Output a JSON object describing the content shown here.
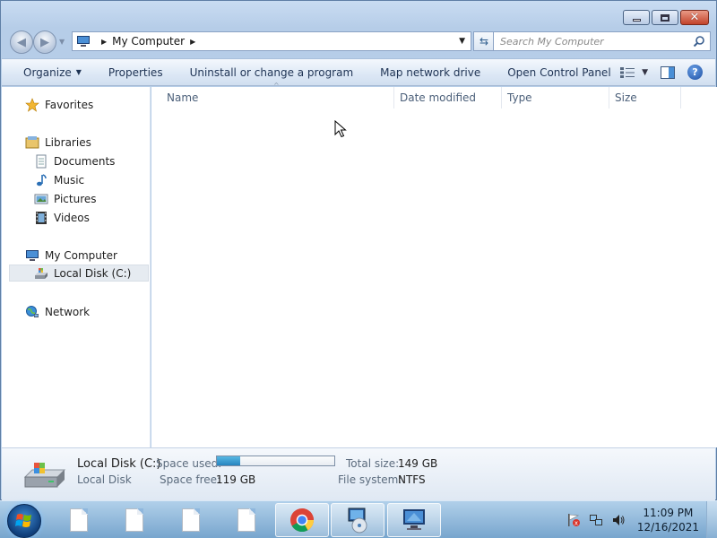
{
  "address": {
    "breadcrumb": [
      "My Computer"
    ],
    "search_placeholder": "Search My Computer"
  },
  "toolbar": {
    "organize": "Organize",
    "properties": "Properties",
    "uninstall": "Uninstall or change a program",
    "map_drive": "Map network drive",
    "control_panel": "Open Control Panel"
  },
  "navpane": {
    "favorites": "Favorites",
    "libraries": "Libraries",
    "documents": "Documents",
    "music": "Music",
    "pictures": "Pictures",
    "videos": "Videos",
    "my_computer": "My Computer",
    "local_disk": "Local Disk (C:)",
    "network": "Network"
  },
  "columns": {
    "name": "Name",
    "date_modified": "Date modified",
    "type": "Type",
    "size": "Size"
  },
  "details": {
    "title": "Local Disk (C:)",
    "subtitle": "Local Disk",
    "space_used_label": "Space used:",
    "space_used_fraction": 0.2,
    "total_size_label": "Total size:",
    "total_size_value": "149 GB",
    "space_free_label": "Space free:",
    "space_free_value": "119 GB",
    "file_system_label": "File system:",
    "file_system_value": "NTFS"
  },
  "taskbar": {
    "clock_time": "11:09 PM",
    "clock_date": "12/16/2021"
  }
}
